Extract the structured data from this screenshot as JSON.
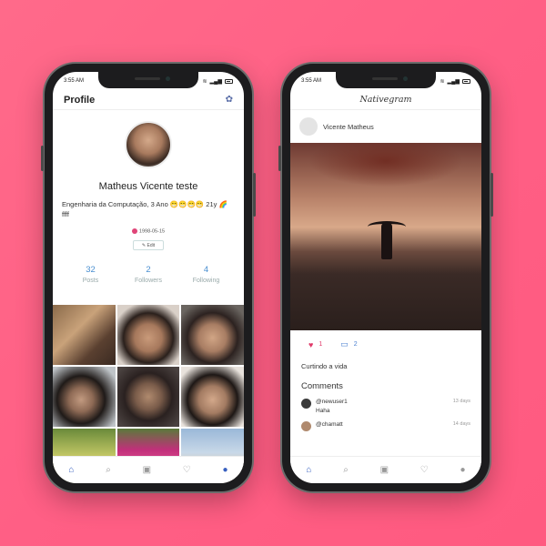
{
  "left": {
    "status_time": "3:55 AM",
    "header_title": "Profile",
    "name": "Matheus Vicente teste",
    "bio": "Engenharia da Computação, 3 Ano 😁😁😁😁 21y 🌈 ffff",
    "birthdate": "1998-05-15",
    "edit_label": "Edit",
    "stats": [
      {
        "num": "32",
        "label": "Posts"
      },
      {
        "num": "2",
        "label": "Followers"
      },
      {
        "num": "4",
        "label": "Following"
      }
    ]
  },
  "right": {
    "status_time": "3:55 AM",
    "brand": "Nativegram",
    "post_user": "Vicente Matheus",
    "likes": "1",
    "comments_count": "2",
    "caption": "Curtindo a vida",
    "comments_title": "Comments",
    "comments": [
      {
        "user": "@newuser1",
        "text": "Haha",
        "time": "13 days"
      },
      {
        "user": "@chamatt",
        "text": "",
        "time": "14 days"
      }
    ]
  },
  "colors": {
    "accent": "#3860c0",
    "stat": "#4a8fd0",
    "like": "#e03a6a",
    "background": "#ff6a8a"
  },
  "icons": [
    "home-icon",
    "search-icon",
    "camera-icon",
    "heart-icon",
    "user-icon",
    "settings-icon",
    "comment-icon"
  ]
}
